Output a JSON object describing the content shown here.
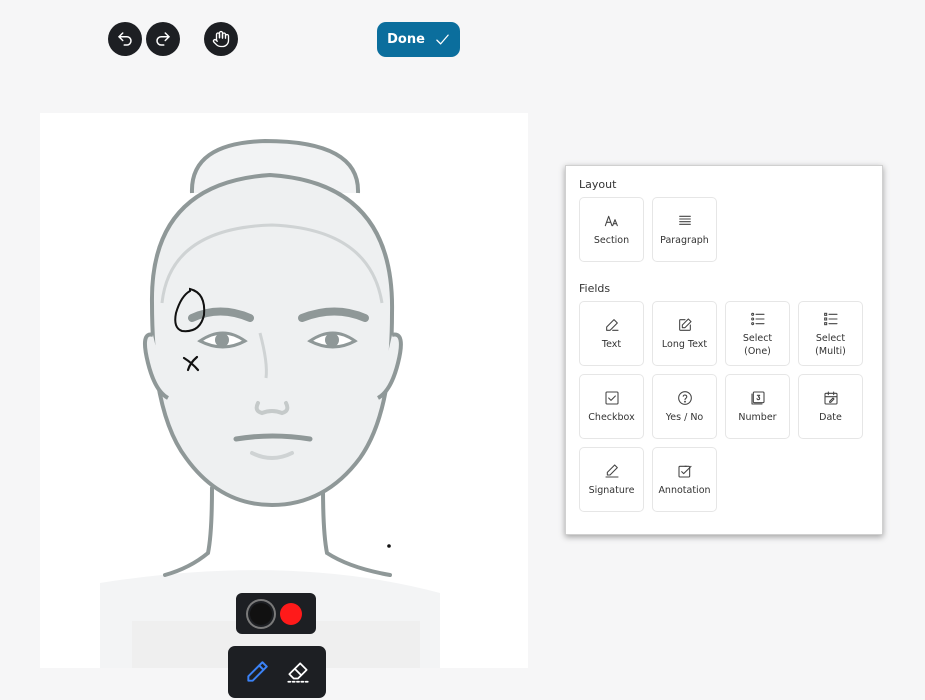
{
  "toolbar": {
    "done_label": "Done",
    "icons": [
      "undo-icon",
      "redo-icon",
      "hand-icon",
      "check-icon"
    ]
  },
  "canvas": {
    "annotations": [
      "circle",
      "x-mark",
      "dot"
    ]
  },
  "colors": {
    "accent": "#0b6e9d",
    "toolbar_bg": "#1d1f23",
    "pen_active": "#3b82f6",
    "swatches": [
      "#111111",
      "#ff1a1a"
    ]
  },
  "bottom_tools": {
    "swatches": [
      "black",
      "red"
    ],
    "tools": [
      "pencil-icon",
      "eraser-icon"
    ]
  },
  "panel": {
    "layout_title": "Layout",
    "fields_title": "Fields",
    "layout_items": [
      {
        "label": "Section",
        "icon": "text-size-icon"
      },
      {
        "label": "Paragraph",
        "icon": "paragraph-icon"
      }
    ],
    "field_items": [
      {
        "label": "Text",
        "icon": "pen-icon"
      },
      {
        "label": "Long Text",
        "icon": "edit-box-icon"
      },
      {
        "label": "Select\n(One)",
        "icon": "list-icon"
      },
      {
        "label": "Select\n(Multi)",
        "icon": "list-icon"
      },
      {
        "label": "Checkbox",
        "icon": "checkbox-icon"
      },
      {
        "label": "Yes / No",
        "icon": "question-icon"
      },
      {
        "label": "Number",
        "icon": "number-icon"
      },
      {
        "label": "Date",
        "icon": "calendar-icon"
      },
      {
        "label": "Signature",
        "icon": "signature-icon"
      },
      {
        "label": "Annotation",
        "icon": "annotation-icon"
      }
    ]
  }
}
